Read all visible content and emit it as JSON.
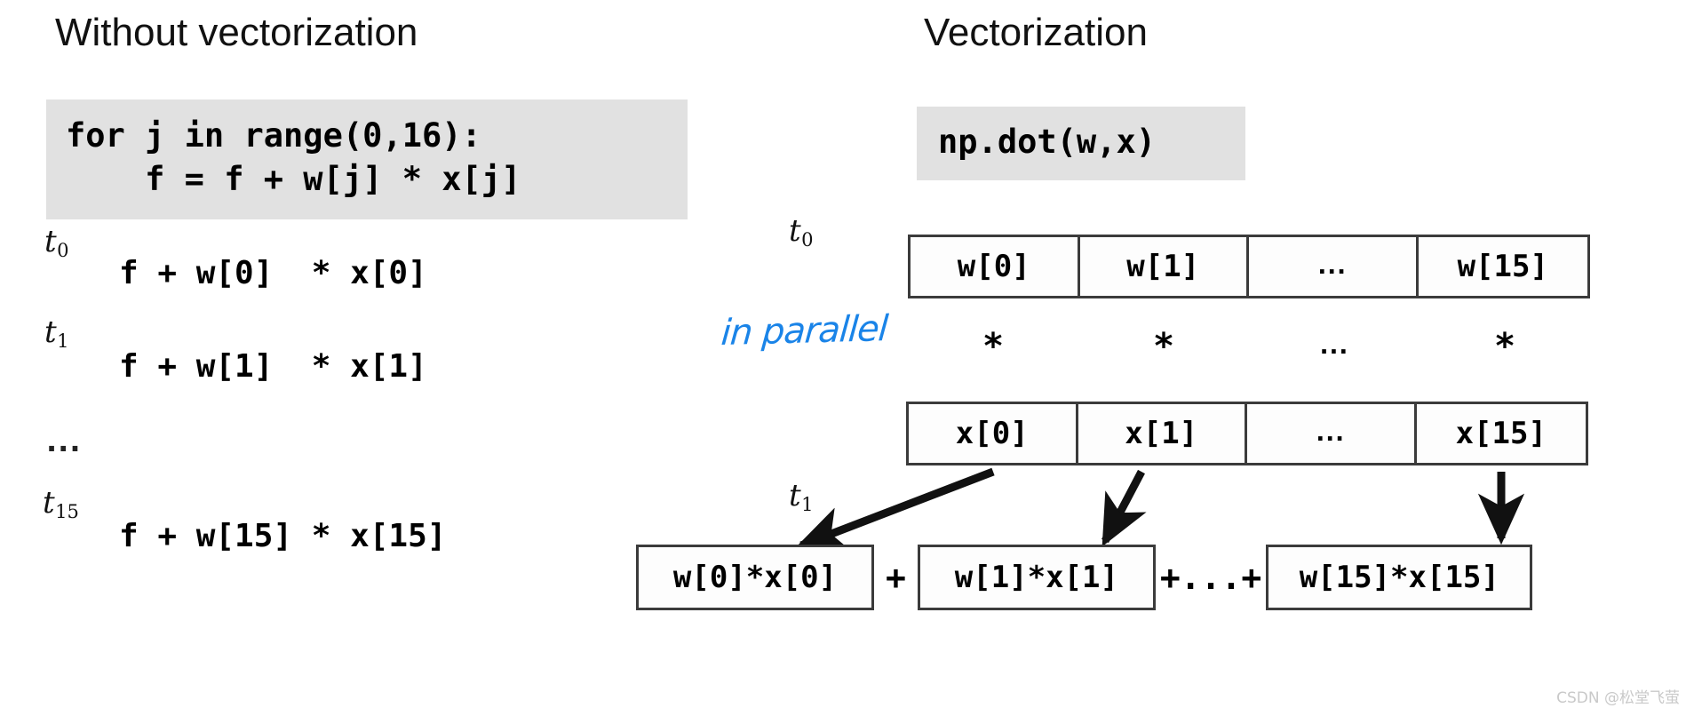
{
  "left_column": {
    "title": "Without vectorization",
    "code": "for j in range(0,16):\n    f = f + w[j] * x[j]",
    "steps": [
      {
        "time_label": "t",
        "time_sub": "0",
        "expression": "f + w[0]  * x[0]"
      },
      {
        "time_label": "t",
        "time_sub": "1",
        "expression": "f + w[1]  * x[1]"
      }
    ],
    "ellipsis": "...",
    "last_step": {
      "time_label": "t",
      "time_sub": "15",
      "expression": "f + w[15] * x[15]"
    }
  },
  "right_column": {
    "title": "Vectorization",
    "code": "np.dot(w,x)",
    "time_label_top": "t",
    "time_sub_top": "0",
    "time_label_bottom": "t",
    "time_sub_bottom": "1",
    "w_vector": [
      "w[0]",
      "w[1]",
      "...",
      "w[15]"
    ],
    "operators": [
      "*",
      "*",
      "...",
      "*"
    ],
    "x_vector": [
      "x[0]",
      "x[1]",
      "...",
      "x[15]"
    ],
    "annotation": "in parallel",
    "annotation_color": "#1a84e8",
    "products": [
      "w[0]*x[0]",
      "w[1]*x[1]",
      "w[15]*x[15]"
    ],
    "separators": [
      "+",
      "+...+"
    ]
  },
  "watermark": "CSDN @松堂飞萤",
  "colors": {
    "code_background": "#e1e1e1",
    "box_border": "#3b3b3b",
    "text": "#000000",
    "handwriting_blue": "#1a84e8",
    "watermark": "#c9c9c9"
  }
}
